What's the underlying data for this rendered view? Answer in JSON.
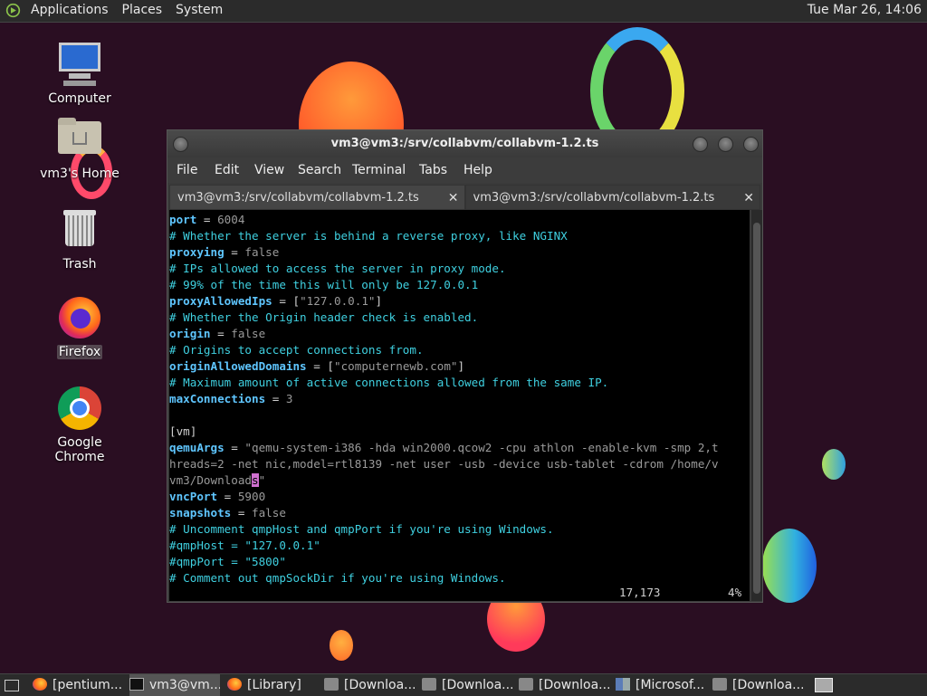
{
  "top_panel": {
    "menus": [
      "Applications",
      "Places",
      "System"
    ],
    "clock": "Tue Mar 26, 14:06"
  },
  "desktop_icons": [
    {
      "label": "Computer",
      "icon": "computer-icon"
    },
    {
      "label": "vm3's Home",
      "icon": "home-folder-icon"
    },
    {
      "label": "Trash",
      "icon": "trash-icon"
    },
    {
      "label": "Firefox",
      "icon": "firefox-icon"
    },
    {
      "label": "Google Chrome",
      "icon": "chrome-icon"
    }
  ],
  "window": {
    "title": "vm3@vm3:/srv/collabvm/collabvm-1.2.ts",
    "menu": [
      "File",
      "Edit",
      "View",
      "Search",
      "Terminal",
      "Tabs",
      "Help"
    ],
    "tabs": [
      {
        "label": "vm3@vm3:/srv/collabvm/collabvm-1.2.ts",
        "close": "✕"
      },
      {
        "label": "vm3@vm3:/srv/collabvm/collabvm-1.2.ts",
        "close": "✕"
      }
    ],
    "terminal": {
      "lines": [
        [
          {
            "t": "port",
            "c": "k"
          },
          {
            "t": " = ",
            "c": "p"
          },
          {
            "t": "6004",
            "c": "v"
          }
        ],
        [
          {
            "t": "# Whether the server is behind a reverse proxy, like NGINX",
            "c": "c"
          }
        ],
        [
          {
            "t": "proxying",
            "c": "k"
          },
          {
            "t": " = ",
            "c": "p"
          },
          {
            "t": "false",
            "c": "v"
          }
        ],
        [
          {
            "t": "# IPs allowed to access the server in proxy mode.",
            "c": "c"
          }
        ],
        [
          {
            "t": "# 99% of the time this will only be 127.0.0.1",
            "c": "c"
          }
        ],
        [
          {
            "t": "proxyAllowedIps",
            "c": "k"
          },
          {
            "t": " = [",
            "c": "p"
          },
          {
            "t": "\"127.0.0.1\"",
            "c": "v"
          },
          {
            "t": "]",
            "c": "p"
          }
        ],
        [
          {
            "t": "# Whether the Origin header check is enabled.",
            "c": "c"
          }
        ],
        [
          {
            "t": "origin",
            "c": "k"
          },
          {
            "t": " = ",
            "c": "p"
          },
          {
            "t": "false",
            "c": "v"
          }
        ],
        [
          {
            "t": "# Origins to accept connections from.",
            "c": "c"
          }
        ],
        [
          {
            "t": "originAllowedDomains",
            "c": "k"
          },
          {
            "t": " = [",
            "c": "p"
          },
          {
            "t": "\"computernewb.com\"",
            "c": "v"
          },
          {
            "t": "]",
            "c": "p"
          }
        ],
        [
          {
            "t": "# Maximum amount of active connections allowed from the same IP.",
            "c": "c"
          }
        ],
        [
          {
            "t": "maxConnections",
            "c": "k"
          },
          {
            "t": " = ",
            "c": "p"
          },
          {
            "t": "3",
            "c": "v"
          }
        ],
        [],
        [
          {
            "t": "[vm]",
            "c": "p"
          }
        ],
        [
          {
            "t": "qemuArgs",
            "c": "k"
          },
          {
            "t": " = ",
            "c": "p"
          },
          {
            "t": "\"qemu-system-i386 -hda win2000.qcow2 -cpu athlon -enable-kvm -smp 2,t",
            "c": "v"
          }
        ],
        [
          {
            "t": "hreads=2 -net nic,model=rtl8139 -net user -usb -device usb-tablet -cdrom /home/v",
            "c": "v"
          }
        ],
        [
          {
            "t": "vm3/Download",
            "c": "v"
          },
          {
            "t": "s",
            "c": "cursor"
          },
          {
            "t": "\"",
            "c": "v"
          }
        ],
        [
          {
            "t": "vncPort",
            "c": "k"
          },
          {
            "t": " = ",
            "c": "p"
          },
          {
            "t": "5900",
            "c": "v"
          }
        ],
        [
          {
            "t": "snapshots",
            "c": "k"
          },
          {
            "t": " = ",
            "c": "p"
          },
          {
            "t": "false",
            "c": "v"
          }
        ],
        [
          {
            "t": "# Uncomment qmpHost and qmpPort if you're using Windows.",
            "c": "c"
          }
        ],
        [
          {
            "t": "#qmpHost = \"127.0.0.1\"",
            "c": "c"
          }
        ],
        [
          {
            "t": "#qmpPort = \"5800\"",
            "c": "c"
          }
        ],
        [
          {
            "t": "# Comment out qmpSockDir if you're using Windows.",
            "c": "c"
          }
        ]
      ],
      "status_position": "17,173",
      "status_percent": "4%"
    }
  },
  "taskbar": {
    "items": [
      {
        "label": "[pentium...",
        "icon": "firefox-icon",
        "active": false
      },
      {
        "label": "vm3@vm...",
        "icon": "terminal-icon",
        "active": true
      },
      {
        "label": "[Library]",
        "icon": "firefox-icon",
        "active": false
      },
      {
        "label": "[Downloa...",
        "icon": "folder-icon",
        "active": false
      },
      {
        "label": "[Downloa...",
        "icon": "folder-icon",
        "active": false
      },
      {
        "label": "[Downloa...",
        "icon": "folder-icon",
        "active": false
      },
      {
        "label": "[Microsof...",
        "icon": "window-icon",
        "active": false
      },
      {
        "label": "[Downloa...",
        "icon": "folder-icon",
        "active": false
      }
    ]
  },
  "colors": {
    "desktop_bg": "#2a0e22",
    "keyword": "#5fc6ff",
    "comment": "#3fd0e0",
    "value": "#9a9a9a",
    "cursor": "#d070d0"
  }
}
